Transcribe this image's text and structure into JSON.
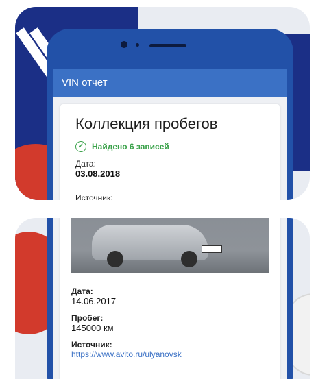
{
  "app": {
    "title": "VIN отчет"
  },
  "card": {
    "title": "Коллекция пробегов",
    "found_text": "Найдено 6 записей"
  },
  "record1": {
    "date_label": "Дата:",
    "date_value": "03.08.2018",
    "source_label": "Источник:"
  },
  "record2": {
    "date_label": "Дата:",
    "date_value": "14.06.2017",
    "mileage_label": "Пробег:",
    "mileage_value": "145000 км",
    "source_label": "Источник:",
    "source_link": "https://www.avito.ru/ulyanovsk"
  },
  "colors": {
    "appbar": "#3b71c5",
    "phone_frame": "#2251a8",
    "success": "#3aa24a",
    "link": "#3b71c5"
  }
}
